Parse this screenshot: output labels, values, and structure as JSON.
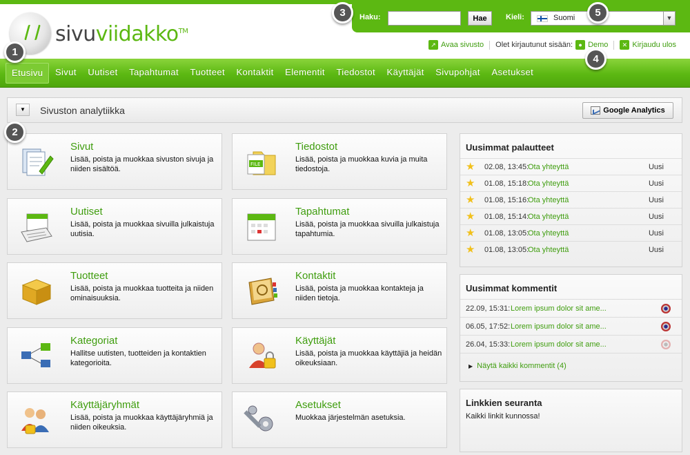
{
  "brand": {
    "name_part1": "sivu",
    "name_part2": "viidakko",
    "tm": "TM"
  },
  "colors": {
    "accent": "#5cb812",
    "link": "#3f9d0e",
    "star": "#f1c01b"
  },
  "search": {
    "label": "Haku:",
    "value": "",
    "placeholder": "",
    "button": "Hae"
  },
  "language": {
    "label": "Kieli:",
    "selected": "Suomi"
  },
  "userbar": {
    "open_site": "Avaa sivusto",
    "logged_in_as": "Olet kirjautunut sisään:",
    "user": "Demo",
    "logout": "Kirjaudu ulos"
  },
  "nav": [
    {
      "label": "Etusivu",
      "active": true
    },
    {
      "label": "Sivut"
    },
    {
      "label": "Uutiset"
    },
    {
      "label": "Tapahtumat"
    },
    {
      "label": "Tuotteet"
    },
    {
      "label": "Kontaktit"
    },
    {
      "label": "Elementit"
    },
    {
      "label": "Tiedostot"
    },
    {
      "label": "Käyttäjät"
    },
    {
      "label": "Sivupohjat"
    },
    {
      "label": "Asetukset"
    }
  ],
  "analytics": {
    "title": "Sivuston analytiikka",
    "button": "Google Analytics"
  },
  "cards": [
    {
      "title": "Sivut",
      "desc": "Lisää, poista ja muokkaa sivuston sivuja ja niiden sisältöä.",
      "icon": "pages-icon"
    },
    {
      "title": "Tiedostot",
      "desc": "Lisää, poista ja muokkaa kuvia ja muita tiedostoja.",
      "icon": "files-icon"
    },
    {
      "title": "Uutiset",
      "desc": "Lisää, poista ja muokkaa sivuilla julkaistuja uutisia.",
      "icon": "news-icon"
    },
    {
      "title": "Tapahtumat",
      "desc": "Lisää, poista ja muokkaa sivuilla julkaistuja tapahtumia.",
      "icon": "calendar-icon"
    },
    {
      "title": "Tuotteet",
      "desc": "Lisää, poista ja muokkaa tuotteita ja niiden ominaisuuksia.",
      "icon": "box-icon"
    },
    {
      "title": "Kontaktit",
      "desc": "Lisää, poista ja muokkaa kontakteja ja niiden tietoja.",
      "icon": "addressbook-icon"
    },
    {
      "title": "Kategoriat",
      "desc": "Hallitse uutisten, tuotteiden ja kontaktien kategorioita.",
      "icon": "hierarchy-icon"
    },
    {
      "title": "Käyttäjät",
      "desc": "Lisää, poista ja muokkaa käyttäjiä ja heidän oikeuksiaan.",
      "icon": "user-lock-icon"
    },
    {
      "title": "Käyttäjäryhmät",
      "desc": "Lisää, poista ja muokkaa käyttäjäryhmiä ja niiden oikeuksia.",
      "icon": "group-lock-icon"
    },
    {
      "title": "Asetukset",
      "desc": "Muokkaa järjestelmän asetuksia.",
      "icon": "tools-icon"
    }
  ],
  "feedback": {
    "title": "Uusimmat palautteet",
    "items": [
      {
        "time": "02.08, 13:45:",
        "link": "Ota yhteyttä",
        "status": "Uusi"
      },
      {
        "time": "01.08, 15:18:",
        "link": "Ota yhteyttä",
        "status": "Uusi"
      },
      {
        "time": "01.08, 15:16:",
        "link": "Ota yhteyttä",
        "status": "Uusi"
      },
      {
        "time": "01.08, 15:14:",
        "link": "Ota yhteyttä",
        "status": "Uusi"
      },
      {
        "time": "01.08, 13:05:",
        "link": "Ota yhteyttä",
        "status": "Uusi"
      },
      {
        "time": "01.08, 13:05:",
        "link": "Ota yhteyttä",
        "status": "Uusi"
      }
    ]
  },
  "comments": {
    "title": "Uusimmat kommentit",
    "items": [
      {
        "time": "22.09, 15:31:",
        "link": "Lorem ipsum dolor sit ame..."
      },
      {
        "time": "06.05, 17:52:",
        "link": "Lorem ipsum dolor sit ame..."
      },
      {
        "time": "26.04, 15:33:",
        "link": "Lorem ipsum dolor sit ame..."
      }
    ],
    "show_all": "Näytä kaikki kommentit (4)"
  },
  "links": {
    "title": "Linkkien seuranta",
    "status": "Kaikki linkit kunnossa!"
  },
  "badges": [
    "1",
    "2",
    "3",
    "4",
    "5"
  ]
}
